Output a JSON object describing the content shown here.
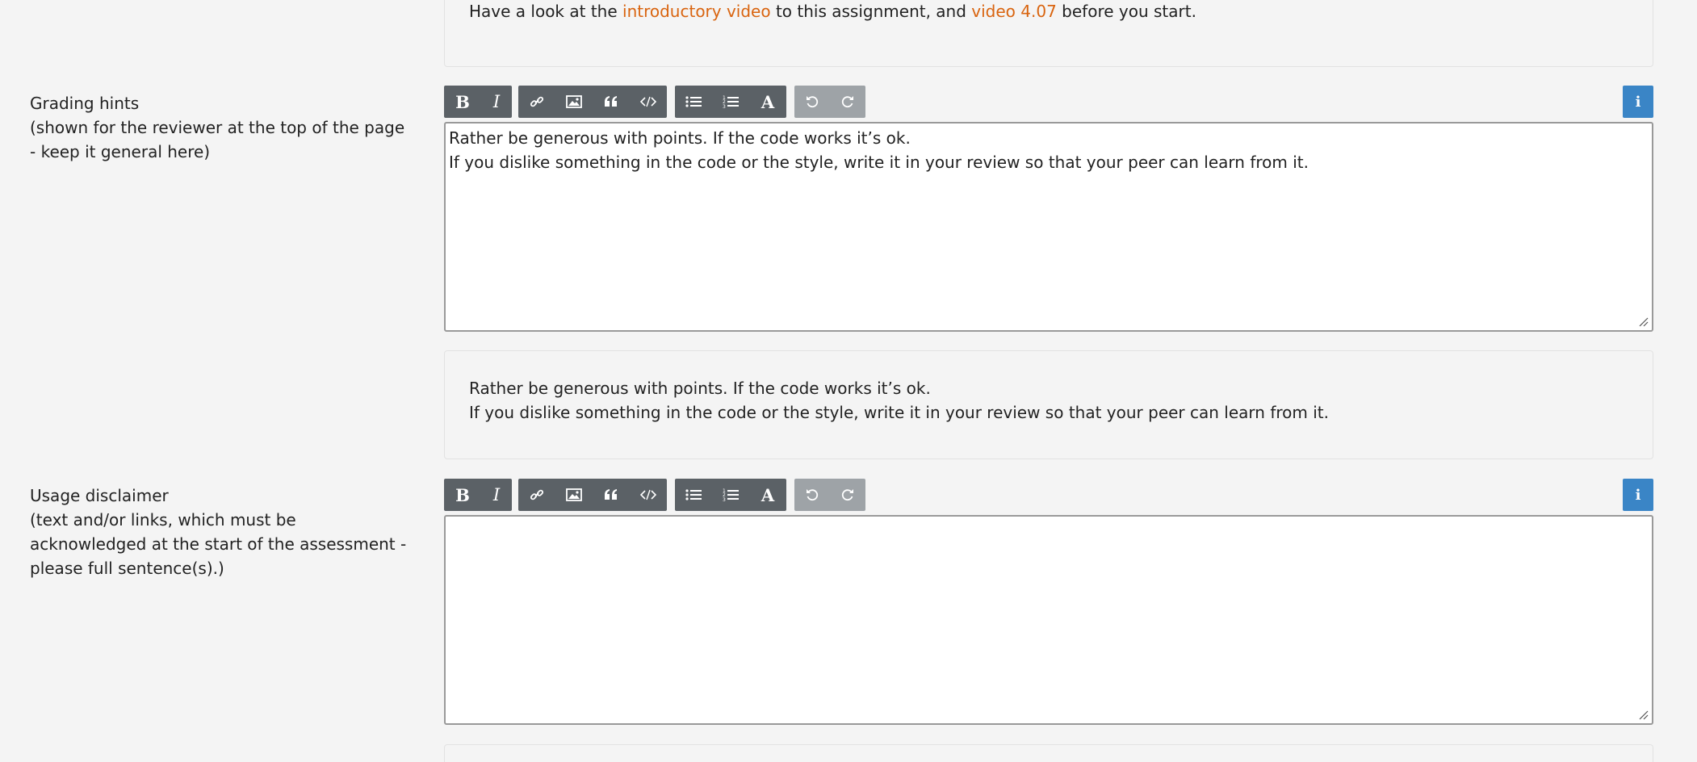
{
  "intro_preview": {
    "before": "Have a look at the ",
    "link1": "introductory video",
    "middle": " to this assignment, and ",
    "link2": "video 4.07",
    "after": " before you start."
  },
  "grading_hints": {
    "label": "Grading hints",
    "sublabel": "(shown for the reviewer at the top of the page - keep it general here)",
    "editor_lines": [
      "Rather be generous with points. If the code works it’s ok.",
      "If you dislike something in the code or the style, write it in your review so that your peer can learn from it."
    ],
    "preview_lines": [
      "Rather be generous with points. If the code works it’s ok.",
      "If you dislike something in the code or the style, write it in your review so that your peer can learn from it."
    ]
  },
  "usage_disclaimer": {
    "label": "Usage disclaimer",
    "sublabel": "(text and/or links, which must be acknowledged at the start of the assessment - please full sentence(s).)",
    "editor_value": ""
  },
  "toolbar": {
    "bold": "B",
    "italic": "I",
    "heading": "A",
    "info": "i",
    "icons": [
      "bold-icon",
      "italic-icon",
      "link-icon",
      "image-icon",
      "quote-icon",
      "code-icon",
      "bullet-list-icon",
      "numbered-list-icon",
      "heading-icon",
      "undo-icon",
      "redo-icon",
      "info-icon"
    ]
  },
  "colors": {
    "link": "#d9640f",
    "toolbar_dark": "#5b6166",
    "toolbar_light": "#9ea3a7",
    "info": "#3a85c6",
    "background": "#f4f4f4"
  }
}
